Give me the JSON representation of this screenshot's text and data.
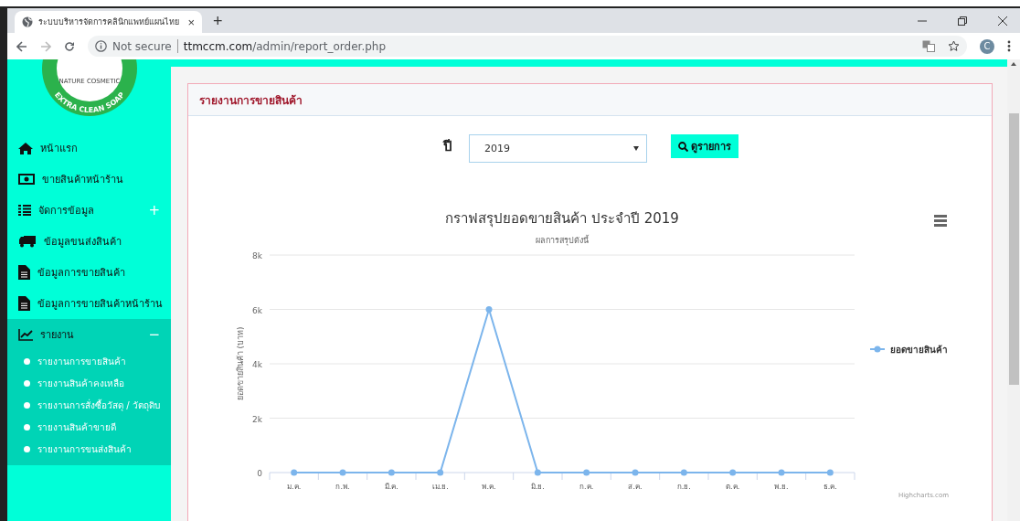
{
  "browser": {
    "tab_title": "ระบบบริหารจัดการคลินิกแพทย์แผนไทย",
    "tab_close": "×",
    "new_tab": "+",
    "security": "Not secure",
    "url_host": "ttmccm.com",
    "url_path": "/admin/report_order.php",
    "profile_initial": "C"
  },
  "sidebar": {
    "logo": {
      "top_text": "NATURE COSMETIC",
      "ring_text": "EXTRA CLEAN SOAP"
    },
    "items": [
      {
        "label": "หน้าแรก",
        "expanded": false
      },
      {
        "label": "ขายสินค้าหน้าร้าน",
        "expanded": false
      },
      {
        "label": "จัดการข้อมูล",
        "toggle": "+",
        "expanded": false
      },
      {
        "label": "ข้อมูลขนส่งสินค้า",
        "expanded": false
      },
      {
        "label": "ข้อมูลการขายสินค้า",
        "expanded": false
      },
      {
        "label": "ข้อมูลการขายสินค้าหน้าร้าน",
        "expanded": false
      },
      {
        "label": "รายงาน",
        "toggle": "−",
        "expanded": true,
        "children": [
          {
            "label": "รายงานการขายสินค้า"
          },
          {
            "label": "รายงานสินค้าคงเหลือ"
          },
          {
            "label": "รายงานการสั่งซื้อวัสดุ / วัตถุดิบ"
          },
          {
            "label": "รายงานสินค้าขายดี"
          },
          {
            "label": "รายงานการขนส่งสินค้า"
          }
        ]
      }
    ]
  },
  "panel": {
    "title": "รายงานการขายสินค้า",
    "filter": {
      "label": "ปี",
      "value": "2019",
      "button": "ดูรายการ"
    },
    "chart": {
      "subtitle": "ผลการสรุปดังนี้",
      "credit": "Highcharts.com",
      "chart_data": {
        "type": "line",
        "title": "กราฟสรุปยอดขายสินค้า ประจำปี 2019",
        "ylabel": "ยอดขายสินค้า (บาท)",
        "categories": [
          "ม.ค.",
          "ก.พ.",
          "มี.ค.",
          "เม.ย.",
          "พ.ค.",
          "มิ.ย.",
          "ก.ค.",
          "ส.ค.",
          "ก.ย.",
          "ต.ค.",
          "พ.ย.",
          "ธ.ค."
        ],
        "series": [
          {
            "name": "ยอดขายสินค้า",
            "color": "#7cb5ec",
            "marker": true,
            "values": [
              0,
              0,
              0,
              0,
              6000,
              0,
              0,
              0,
              0,
              0,
              0,
              0
            ]
          }
        ],
        "grid": true,
        "ylim": [
          0,
          8000
        ],
        "yticks": [
          {
            "value": 0,
            "label": "0"
          },
          {
            "value": 2000,
            "label": "2k"
          },
          {
            "value": 4000,
            "label": "4k"
          },
          {
            "value": 6000,
            "label": "6k"
          },
          {
            "value": 8000,
            "label": "8k"
          }
        ]
      }
    }
  }
}
